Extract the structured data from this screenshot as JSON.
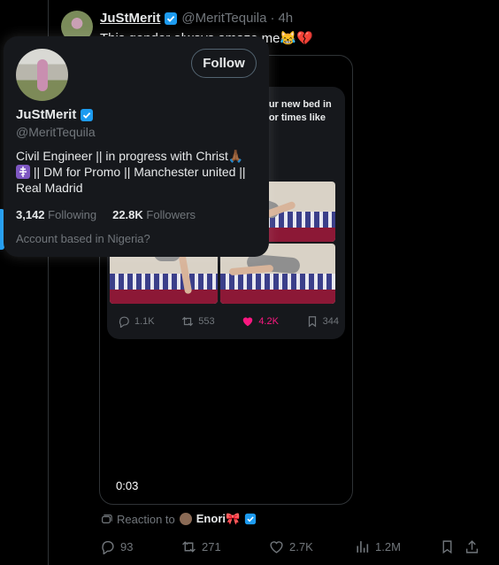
{
  "tweet": {
    "author_name": "JuStMerit",
    "author_handle": "@MeritTequila",
    "time": "4h",
    "separator": "·",
    "text": "This gender always amaze me😹💔",
    "video_duration": "0:03",
    "embedded_post": {
      "text_line1": "your new bed in",
      "text_line2": "y for times like",
      "replies": "1.1K",
      "reposts": "553",
      "likes": "4.2K",
      "views": "344"
    },
    "reaction": {
      "prefix": "Reaction to",
      "name": "Enori🎀"
    },
    "actions": {
      "replies": "93",
      "reposts": "271",
      "likes": "2.7K",
      "views": "1.2M"
    }
  },
  "hover_card": {
    "name": "JuStMerit",
    "handle": "@MeritTequila",
    "follow_label": "Follow",
    "bio_part1": "Civil Engineer || in progress with Christ🙏🏾",
    "bio_part2": " || DM for Promo || Manchester united || Real Madrid",
    "following_count": "3,142",
    "following_label": "Following",
    "followers_count": "22.8K",
    "followers_label": "Followers",
    "location_note": "Account based in Nigeria?"
  },
  "colors": {
    "background": "#000000",
    "card": "#16181c",
    "verified_blue": "#1d9bf0",
    "like_pink": "#f91880",
    "muted_text": "#71767b"
  },
  "icons": [
    "verified-badge-icon",
    "reply-icon",
    "repost-icon",
    "like-icon",
    "views-icon",
    "bookmark-icon",
    "share-icon",
    "reaction-icon",
    "orthodox-cross-icon"
  ]
}
